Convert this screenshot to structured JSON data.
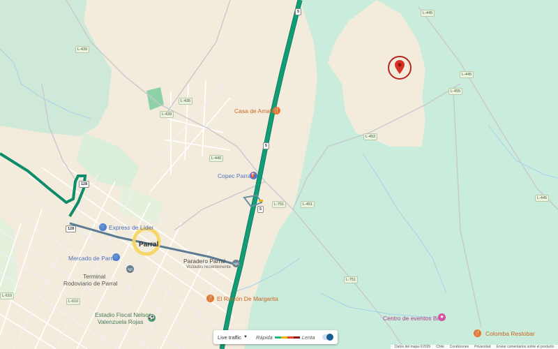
{
  "map": {
    "roads": {
      "r5": "5",
      "r128": "128",
      "l439": "L-439",
      "l435": "L-435",
      "l440": "L-440",
      "l445_top": "L-445",
      "l445_mid": "L-445",
      "l455": "L-455",
      "l453": "L-453",
      "l751": "L-751",
      "l451": "L-451",
      "l445_right": "L-445",
      "l610": "L-610",
      "l751_low": "L-751",
      "l439_top": "L-439"
    },
    "places": {
      "casa_amalia": "Casa de Amalia",
      "copec": "Copec Parral",
      "express_lider": "Express de Líder",
      "parral": "Parral",
      "mercado": "Mercado de Parral",
      "terminal_line1": "Terminal",
      "terminal_line2": "Rodoviario de Parral",
      "paradero": "Paradero Parral",
      "paradero_sub": "Visitados recientemente",
      "rincon": "El Rincón De Margarita",
      "estadio_line1": "Estadio Fiscal Nelson",
      "estadio_line2": "Valenzuela Rojas",
      "centro_balu": "Centro de eventos Balu",
      "colomba": "Colomba Restobar"
    },
    "icons": {
      "restaurant": "restaurant-icon",
      "gas": "gas-station-icon",
      "shop": "shopping-icon",
      "bus": "bus-stop-icon",
      "stadium": "stadium-icon",
      "event": "event-venue-icon",
      "pin": "location-pin-icon"
    },
    "colors": {
      "highway": "#119e77",
      "restaurant": "#e8772d",
      "services": "#4f7fd8",
      "event": "#d34fa0",
      "pin": "#d93025"
    }
  },
  "legend": {
    "live_traffic": "Live traffic",
    "fast": "Rápida",
    "slow": "Lenta",
    "fast_color": "#1fb58f",
    "slow_color": "#c7342c"
  },
  "footer": {
    "map_data": "Datos del mapa ©2026",
    "country": "Chile",
    "terms": "Condiciones",
    "privacy": "Privacidad",
    "feedback": "Enviar comentarios sobre el producto"
  }
}
